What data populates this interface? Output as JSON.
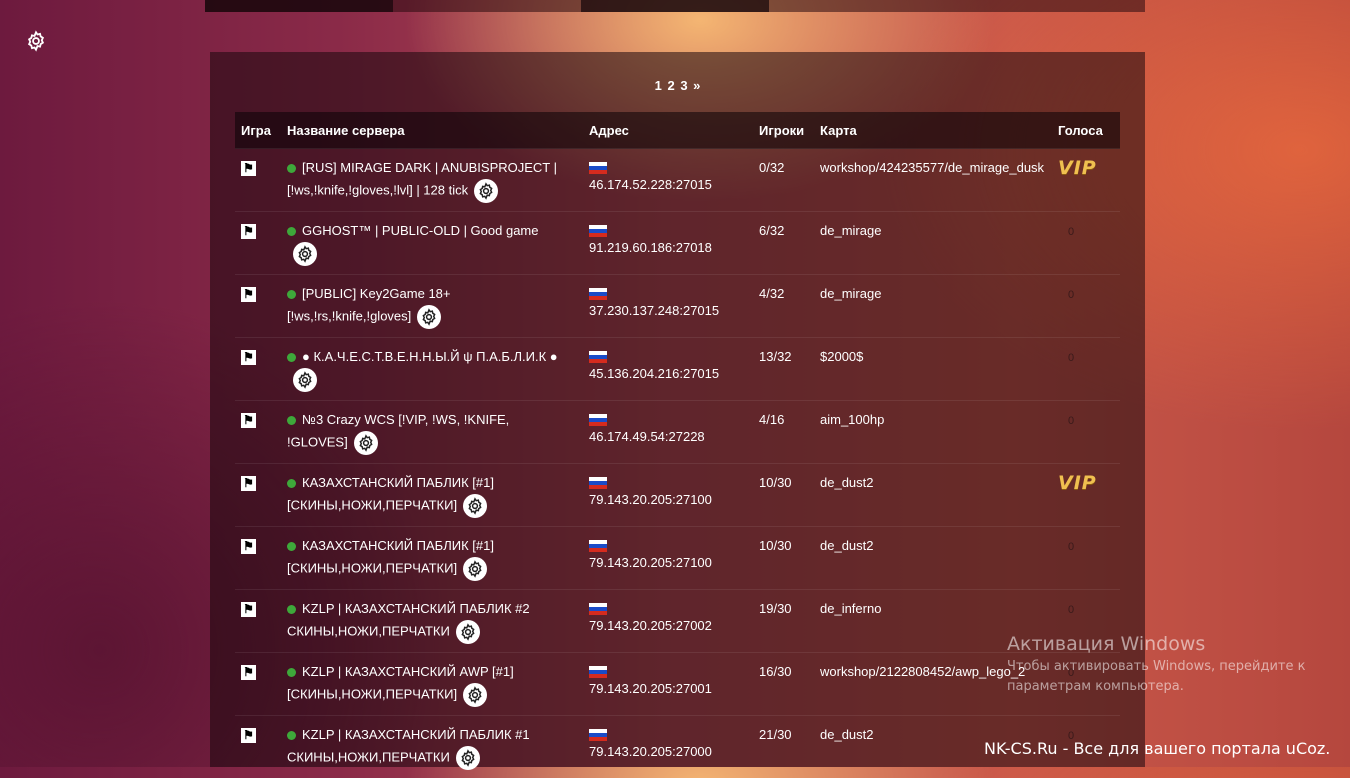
{
  "pagination": {
    "pages": [
      "1",
      "2",
      "3"
    ],
    "next": "»"
  },
  "table": {
    "headers": {
      "game": "Игра",
      "name": "Название сервера",
      "address": "Адрес",
      "players": "Игроки",
      "map": "Карта",
      "votes": "Голоса"
    },
    "rows": [
      {
        "name_line1": "[RUS] MIRAGE DARK | ANUBISPROJECT |",
        "name_line2": "[!ws,!knife,!gloves,!lvl] | 128 tick",
        "address": "46.174.52.228:27015",
        "players": "0/32",
        "map": "workshop/424235577/de_mirage_dusk",
        "votes": "VIP"
      },
      {
        "name_line1": "GGHOST™ | PUBLIC-OLD | Good game",
        "name_line2": "",
        "address": "91.219.60.186:27018",
        "players": "6/32",
        "map": "de_mirage",
        "votes": "0"
      },
      {
        "name_line1": "[PUBLIC] Key2Game 18+",
        "name_line2": "[!ws,!rs,!knife,!gloves]",
        "address": "37.230.137.248:27015",
        "players": "4/32",
        "map": "de_mirage",
        "votes": "0"
      },
      {
        "name_line1": "● К.А.Ч.Е.С.Т.В.Е.Н.Н.Ы.Й ψ П.А.Б.Л.И.К ●",
        "name_line2": "",
        "address": "45.136.204.216:27015",
        "players": "13/32",
        "map": "$2000$",
        "votes": "0"
      },
      {
        "name_line1": "№3 Crazy WCS [!VIP, !WS, !KNIFE,",
        "name_line2": "!GLOVES]",
        "address": "46.174.49.54:27228",
        "players": "4/16",
        "map": "aim_100hp",
        "votes": "0"
      },
      {
        "name_line1": "КАЗАХСТАНСКИЙ ПАБЛИК [#1]",
        "name_line2": "[СКИНЫ,НОЖИ,ПЕРЧАТКИ]",
        "address": "79.143.20.205:27100",
        "players": "10/30",
        "map": "de_dust2",
        "votes": "VIP"
      },
      {
        "name_line1": "КАЗАХСТАНСКИЙ ПАБЛИК [#1]",
        "name_line2": "[СКИНЫ,НОЖИ,ПЕРЧАТКИ]",
        "address": "79.143.20.205:27100",
        "players": "10/30",
        "map": "de_dust2",
        "votes": "0"
      },
      {
        "name_line1": "KZLP | КАЗАХСТАНСКИЙ ПАБЛИК #2",
        "name_line2": "СКИНЫ,НОЖИ,ПЕРЧАТКИ",
        "address": "79.143.20.205:27002",
        "players": "19/30",
        "map": "de_inferno",
        "votes": "0"
      },
      {
        "name_line1": "KZLP | КАЗАХСТАНСКИЙ AWP [#1]",
        "name_line2": "[СКИНЫ,НОЖИ,ПЕРЧАТКИ]",
        "address": "79.143.20.205:27001",
        "players": "16/30",
        "map": "workshop/2122808452/awp_lego_2",
        "votes": "0"
      },
      {
        "name_line1": "KZLP | КАЗАХСТАНСКИЙ ПАБЛИК #1",
        "name_line2": "СКИНЫ,НОЖИ,ПЕРЧАТКИ",
        "address": "79.143.20.205:27000",
        "players": "21/30",
        "map": "de_dust2",
        "votes": "0"
      }
    ]
  },
  "watermark": {
    "title": "Активация Windows",
    "subtitle": "Чтобы активировать Windows, перейдите к параметрам компьютера."
  },
  "footer": "NK-CS.Ru - Все для вашего портала uCoz."
}
